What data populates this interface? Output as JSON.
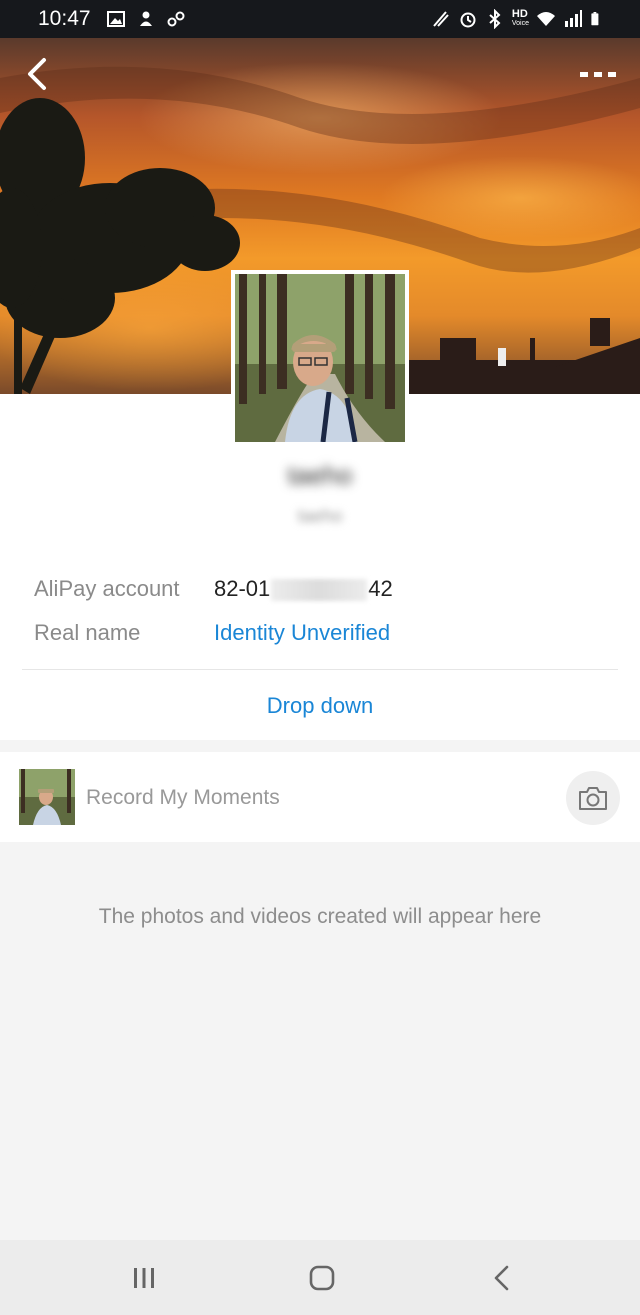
{
  "status_bar": {
    "time": "10:47",
    "left_icons": [
      "image-icon",
      "notification-icon",
      "link-icon"
    ],
    "right_icons": [
      "nfc-icon",
      "alarm-icon",
      "bluetooth-icon",
      "hd-voice-icon",
      "wifi-icon",
      "signal-icon",
      "battery-icon"
    ],
    "hd_text": "HD",
    "voice_text": "Voice"
  },
  "header": {
    "back_icon": "chevron-left-icon",
    "more_icon": "more-dots-icon"
  },
  "profile": {
    "name": "taeho",
    "subname": "taeho",
    "rows": [
      {
        "label": "AliPay account",
        "value_prefix": "82-01",
        "value_suffix": "42"
      },
      {
        "label": "Real name",
        "value": "Identity Unverified"
      }
    ],
    "dropdown_label": "Drop down"
  },
  "moments": {
    "label": "Record My Moments",
    "camera_icon": "camera-icon"
  },
  "empty_state": {
    "text": "The photos and videos created will appear here"
  },
  "nav_bar": {
    "icons": [
      "recents-icon",
      "home-icon",
      "back-icon"
    ]
  }
}
